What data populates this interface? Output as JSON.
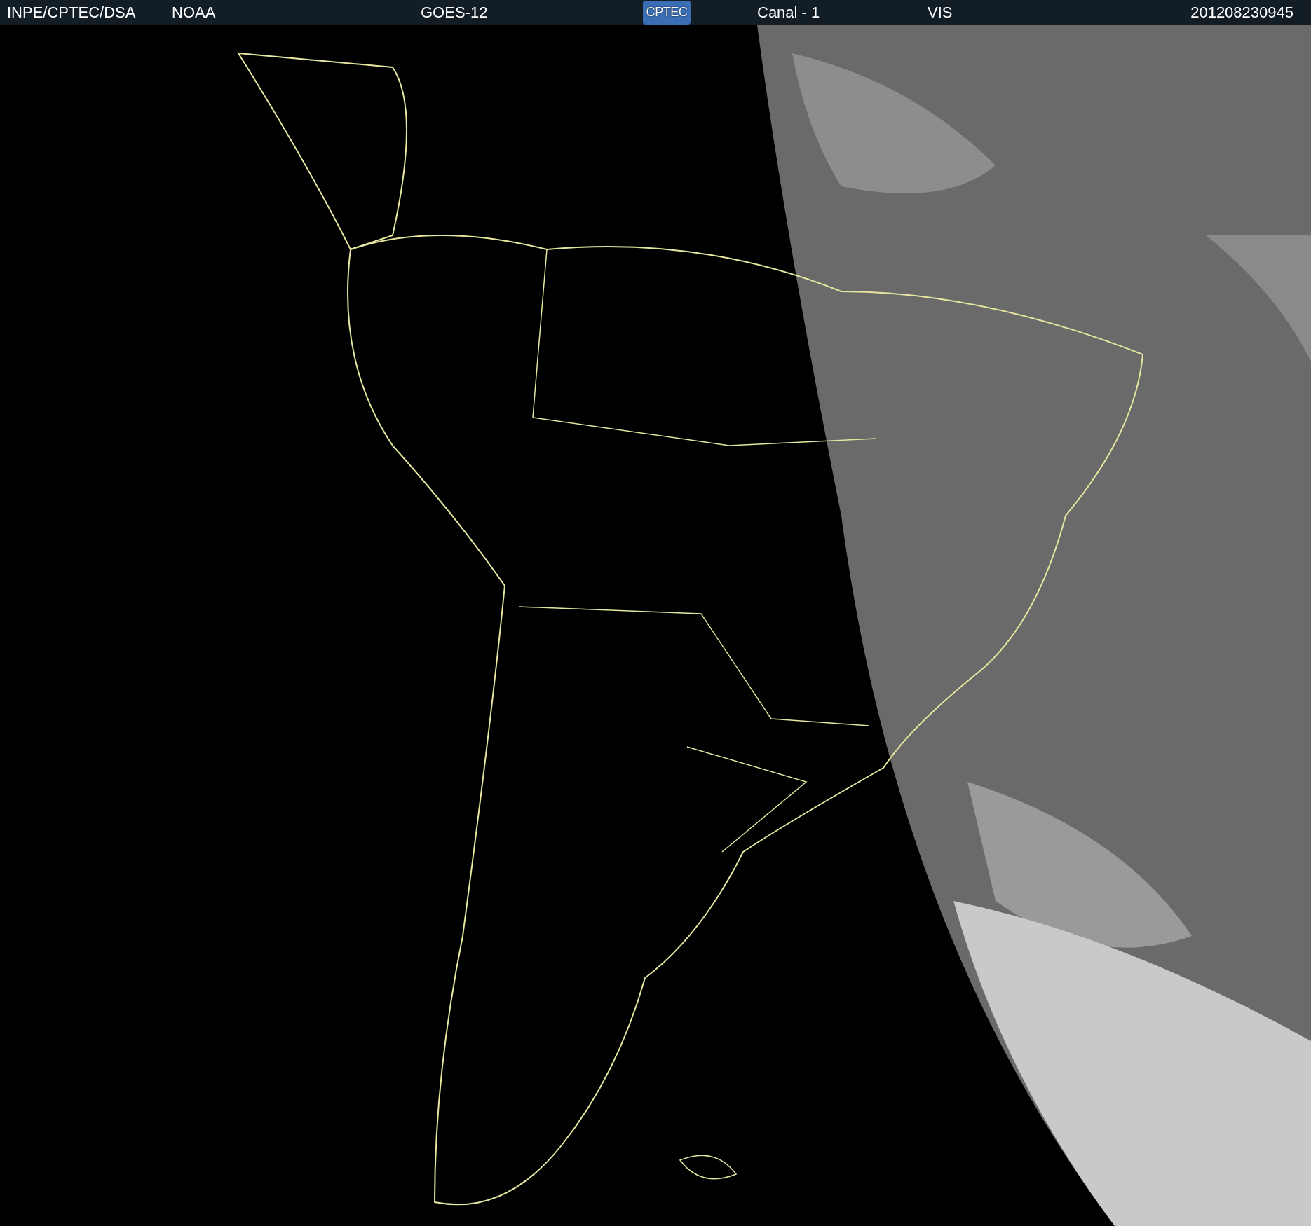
{
  "header": {
    "source": "INPE/CPTEC/DSA",
    "agency": "NOAA",
    "satellite": "GOES-12",
    "logo": "CPTEC",
    "channel": "Canal - 1",
    "band": "VIS",
    "timestamp": "201208230945"
  }
}
